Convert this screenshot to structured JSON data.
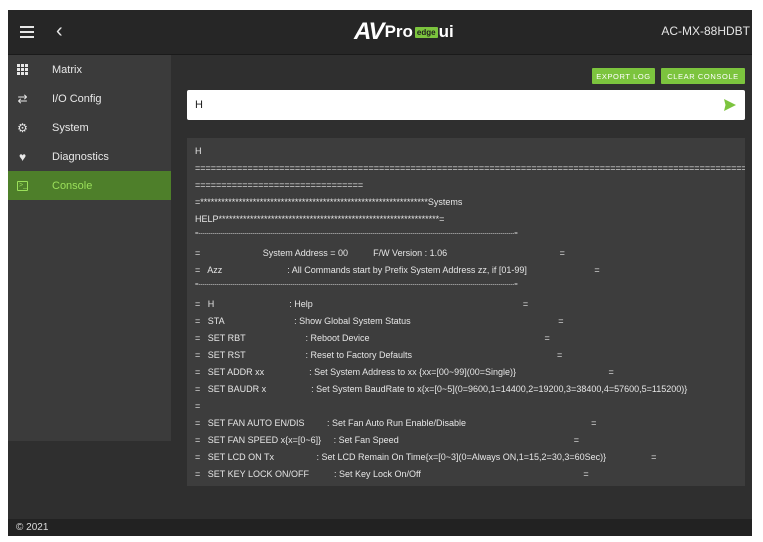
{
  "header": {
    "logo_av": "AV",
    "logo_pro": "Pro",
    "logo_edge": "edge",
    "logo_ui": "ui",
    "model": "AC-MX-88HDBT"
  },
  "sidebar": {
    "items": [
      {
        "label": "Matrix",
        "icon": "grid-icon"
      },
      {
        "label": "I/O Config",
        "icon": "swap-arrows-icon"
      },
      {
        "label": "System",
        "icon": "gear-icon"
      },
      {
        "label": "Diagnostics",
        "icon": "heart-pulse-icon"
      },
      {
        "label": "Console",
        "icon": "terminal-icon",
        "active": true
      }
    ]
  },
  "toolbar": {
    "export_label": "EXPORT LOG",
    "clear_label": "CLEAR CONSOLE"
  },
  "command": {
    "value": "H"
  },
  "console": {
    "lines": [
      "H",
      "==================================================================================================================================",
      "================================",
      "=*****************************************************************Systems",
      "HELP***************************************************************=",
      "=--------------------------------------------------------------------------------------------------------------------------------------------------------------=",
      "=                         System Address = 00          F/W Version : 1.06                                             =",
      "=   Azz                          : All Commands start by Prefix System Address zz, if [01-99]                           =",
      "=--------------------------------------------------------------------------------------------------------------------------------------------------------------=",
      "=   H                              : Help                                                                                    =",
      "=   STA                            : Show Global System Status                                                           =",
      "=   SET RBT                        : Reboot Device                                                                      =",
      "=   SET RST                        : Reset to Factory Defaults                                                          =",
      "=   SET ADDR xx                  : Set System Address to xx {xx=[00~99](00=Single)}                                     =",
      "=   SET BAUDR x                  : Set System BaudRate to x{x=[0~5](0=9600,1=14400,2=19200,3=38400,4=57600,5=115200)}",
      "=",
      "=   SET FAN AUTO EN/DIS         : Set Fan Auto Run Enable/Disable                                                  =",
      "=   SET FAN SPEED x{x=[0~6]}     : Set Fan Speed                                                                      =",
      "=   SET LCD ON Tx                 : Set LCD Remain On Time{x=[0~3](0=Always ON,1=15,2=30,3=60Sec)}                  =",
      "=   SET KEY LOCK ON/OFF          : Set Key Lock On/Off                                                                 ="
    ]
  },
  "footer": {
    "copyright": "© 2021"
  },
  "colors": {
    "accent": "#7cc43e",
    "active_bg": "#4e7f2a",
    "background": "#2f2f2f"
  }
}
